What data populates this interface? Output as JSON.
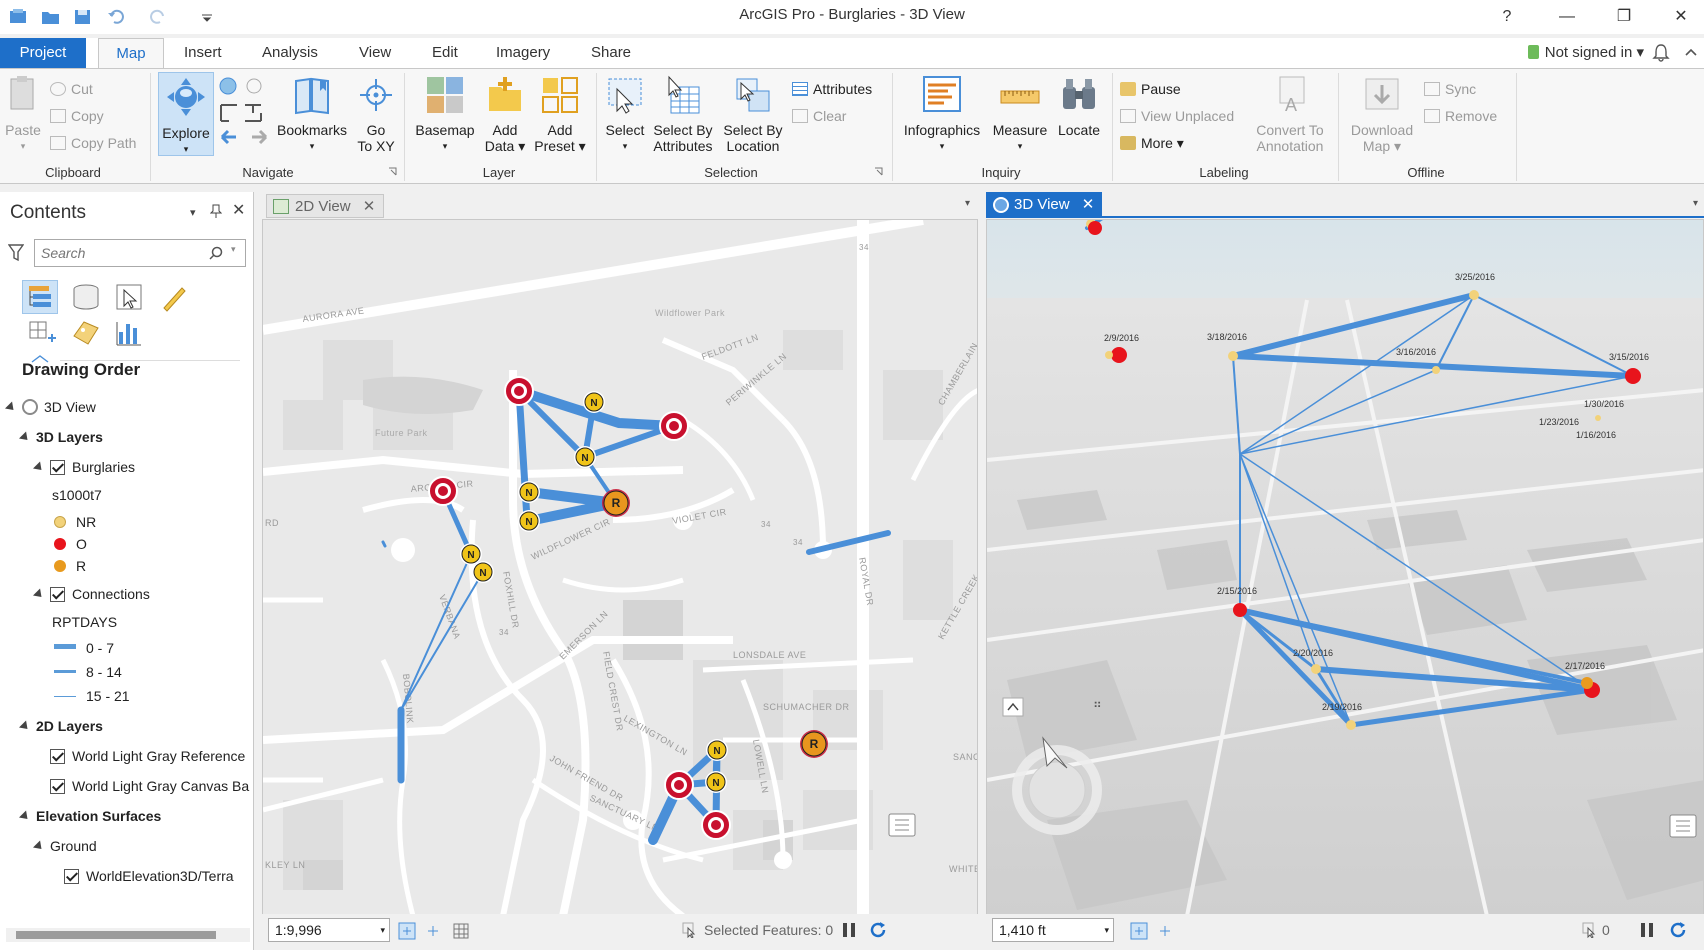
{
  "app": {
    "title": "ArcGIS Pro - Burglaries - 3D View"
  },
  "window_controls": {
    "help": "?",
    "minimize": "—",
    "restore": "❐",
    "close": "✕"
  },
  "ribbon_tabs": [
    "Project",
    "Map",
    "Insert",
    "Analysis",
    "View",
    "Edit",
    "Imagery",
    "Share"
  ],
  "account": {
    "label": "Not signed in"
  },
  "ribbon": {
    "clipboard": {
      "group": "Clipboard",
      "paste": "Paste",
      "cut": "Cut",
      "copy": "Copy",
      "copy_path": "Copy Path"
    },
    "navigate": {
      "group": "Navigate",
      "explore": "Explore",
      "bookmarks": "Bookmarks",
      "go_to_xy_1": "Go",
      "go_to_xy_2": "To XY"
    },
    "layer": {
      "group": "Layer",
      "basemap": "Basemap",
      "add_data_1": "Add",
      "add_data_2": "Data",
      "add_preset_1": "Add",
      "add_preset_2": "Preset"
    },
    "selection": {
      "group": "Selection",
      "select": "Select",
      "select_by_attr_1": "Select By",
      "select_by_attr_2": "Attributes",
      "select_by_loc_1": "Select By",
      "select_by_loc_2": "Location",
      "attributes": "Attributes",
      "clear": "Clear"
    },
    "inquiry": {
      "group": "Inquiry",
      "infographics": "Infographics",
      "measure": "Measure",
      "locate": "Locate"
    },
    "labeling": {
      "group": "Labeling",
      "pause": "Pause",
      "view_unplaced": "View Unplaced",
      "more": "More",
      "convert_1": "Convert To",
      "convert_2": "Annotation"
    },
    "offline": {
      "group": "Offline",
      "download_1": "Download",
      "download_2": "Map",
      "sync": "Sync",
      "remove": "Remove"
    }
  },
  "contents": {
    "title": "Contents",
    "search_placeholder": "Search",
    "drawing_order": "Drawing Order",
    "tree": {
      "view": "3D View",
      "layers3d": "3D Layers",
      "burglaries": "Burglaries",
      "field": "s1000t7",
      "legend": [
        {
          "label": "NR",
          "color": "#f2d27a"
        },
        {
          "label": "O",
          "color": "#e8141c"
        },
        {
          "label": "R",
          "color": "#e89a1e"
        }
      ],
      "connections": "Connections",
      "conn_field": "RPTDAYS",
      "conn_legend": [
        "0 - 7",
        "8 - 14",
        "15 - 21"
      ],
      "layers2d": "2D Layers",
      "ref": "World Light Gray Reference",
      "canvas": "World Light Gray Canvas Ba",
      "elev": "Elevation Surfaces",
      "ground": "Ground",
      "terrain": "WorldElevation3D/Terra"
    }
  },
  "view2d": {
    "tab": "2D View",
    "scale": "1:9,996",
    "selected": "Selected Features: 0",
    "streets": [
      "AURORA AVE",
      "Wildflower Park",
      "FELDOTT LN",
      "PERIWINKLE LN",
      "Future Park",
      "ARCADIA CIR",
      "VIOLET CIR",
      "WILDFLOWER CIR",
      "FOXHILL DR",
      "VERBANA",
      "EMERSON LN",
      "LONSDALE AVE",
      "SCHUMACHER DR",
      "LEXINGTON LN",
      "FIELD CREST DR",
      "JOHN FRIEND DR",
      "LOWELL LN",
      "SANCTUARY LN",
      "BOBOLINK",
      "CHAMBERLAIN",
      "KETTLE CREEK",
      "SANC",
      "WHITE",
      "ROYAL DR",
      "RD",
      "KLEY LN",
      "34",
      "34",
      "34",
      "34"
    ],
    "markers": [
      {
        "type": "O"
      },
      {
        "type": "O"
      },
      {
        "type": "O"
      },
      {
        "type": "O"
      },
      {
        "type": "O"
      },
      {
        "type": "R"
      },
      {
        "type": "R"
      },
      {
        "type": "N"
      },
      {
        "type": "N"
      },
      {
        "type": "N"
      },
      {
        "type": "N"
      },
      {
        "type": "N"
      },
      {
        "type": "N"
      },
      {
        "type": "N"
      },
      {
        "type": "N"
      }
    ]
  },
  "view3d": {
    "tab": "3D View",
    "scale": "1,410 ft",
    "count": "0",
    "dates": [
      "3/25/2016",
      "2/9/2016",
      "3/18/2016",
      "3/16/2016",
      "3/15/2016",
      "1/30/2016",
      "1/23/2016",
      "1/16/2016",
      "2/15/2016",
      "2/20/2016",
      "2/17/2016",
      "2/19/2016"
    ]
  },
  "colors": {
    "accent": "#1e6fc9",
    "conn": "#4a8fd8",
    "o": "#c8102e",
    "r": "#e8961e",
    "n": "#f0c419"
  }
}
